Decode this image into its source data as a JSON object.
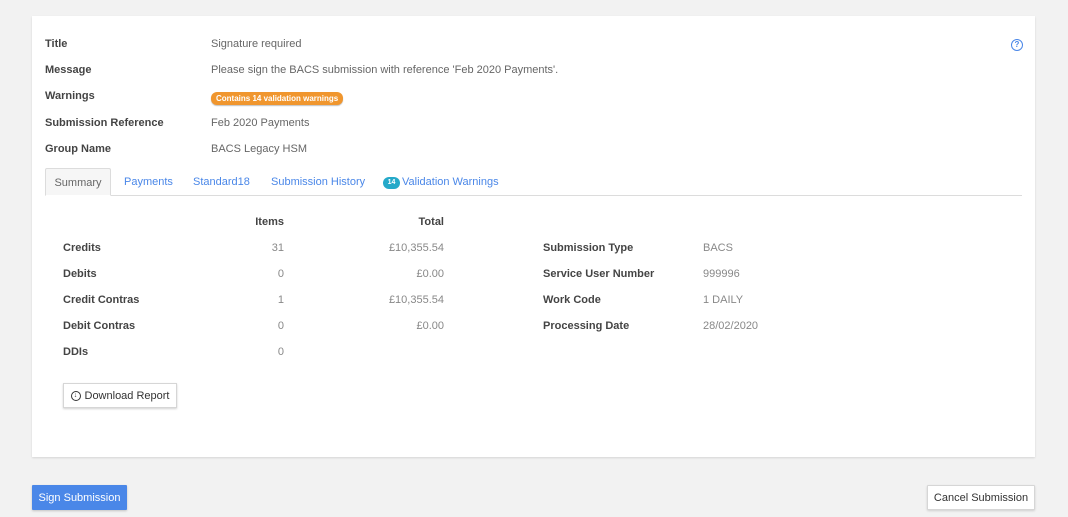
{
  "details": {
    "title_label": "Title",
    "title_value": "Signature required",
    "message_label": "Message",
    "message_value": "Please sign the BACS submission with reference 'Feb 2020 Payments'.",
    "warnings_label": "Warnings",
    "warnings_badge": "Contains 14 validation warnings",
    "submission_reference_label": "Submission Reference",
    "submission_reference_value": "Feb 2020 Payments",
    "group_name_label": "Group Name",
    "group_name_value": "BACS Legacy HSM",
    "help_icon": "?"
  },
  "tabs": [
    {
      "label": "Summary",
      "active": true
    },
    {
      "label": "Payments"
    },
    {
      "label": "Standard18"
    },
    {
      "label": "Submission History"
    },
    {
      "label": "Validation Warnings",
      "badge": "14"
    }
  ],
  "summary": {
    "headers": {
      "items": "Items",
      "total": "Total"
    },
    "rows": [
      {
        "label": "Credits",
        "items": "31",
        "total": "£10,355.54"
      },
      {
        "label": "Debits",
        "items": "0",
        "total": "£0.00"
      },
      {
        "label": "Credit Contras",
        "items": "1",
        "total": "£10,355.54"
      },
      {
        "label": "Debit Contras",
        "items": "0",
        "total": "£0.00"
      },
      {
        "label": "DDIs",
        "items": "0",
        "total": ""
      }
    ],
    "submission_info": [
      {
        "label": "Submission Type",
        "value": "BACS"
      },
      {
        "label": "Service User Number",
        "value": "999996"
      },
      {
        "label": "Work Code",
        "value": "1 DAILY"
      },
      {
        "label": "Processing Date",
        "value": "28/02/2020"
      }
    ],
    "download_icon": "download-circle-icon",
    "download_label": "Download Report"
  },
  "actions": {
    "sign_label": "Sign Submission",
    "cancel_label": "Cancel Submission"
  },
  "colors": {
    "primary": "#4a87e8",
    "warning_badge": "#f0962e",
    "info_badge": "#25a9c9",
    "background": "#f2f2f2"
  }
}
